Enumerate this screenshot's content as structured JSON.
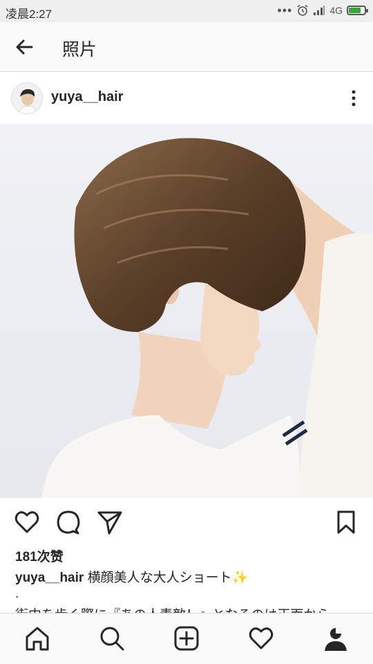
{
  "status_bar": {
    "time": "凌晨2:27",
    "network": "4G",
    "icons": [
      "more-dots-icon",
      "alarm-icon",
      "signal-icon",
      "battery-icon"
    ]
  },
  "app_bar": {
    "title": "照片",
    "back_icon": "arrow-left-icon"
  },
  "post": {
    "username": "yuya__hair",
    "menu_icon": "more-vertical-icon",
    "likes": "181次赞",
    "caption_user": "yuya__hair",
    "caption_text": "横顔美人な大人ショート",
    "caption_emoji": "✨",
    "dot_line": ".",
    "continued_text": "街中を歩く際に『あの人素敵！』となるのは正面から"
  },
  "actions": {
    "icons": [
      "heart-icon",
      "comment-icon",
      "share-icon",
      "bookmark-icon"
    ]
  },
  "bottom_nav": {
    "icons": [
      "home-icon",
      "search-icon",
      "add-post-icon",
      "activity-heart-icon",
      "profile-icon"
    ]
  },
  "colors": {
    "text": "#262626",
    "bar_background": "#fafafa",
    "divider": "#dbdbdb",
    "status_bar": "#f0f0f0"
  }
}
